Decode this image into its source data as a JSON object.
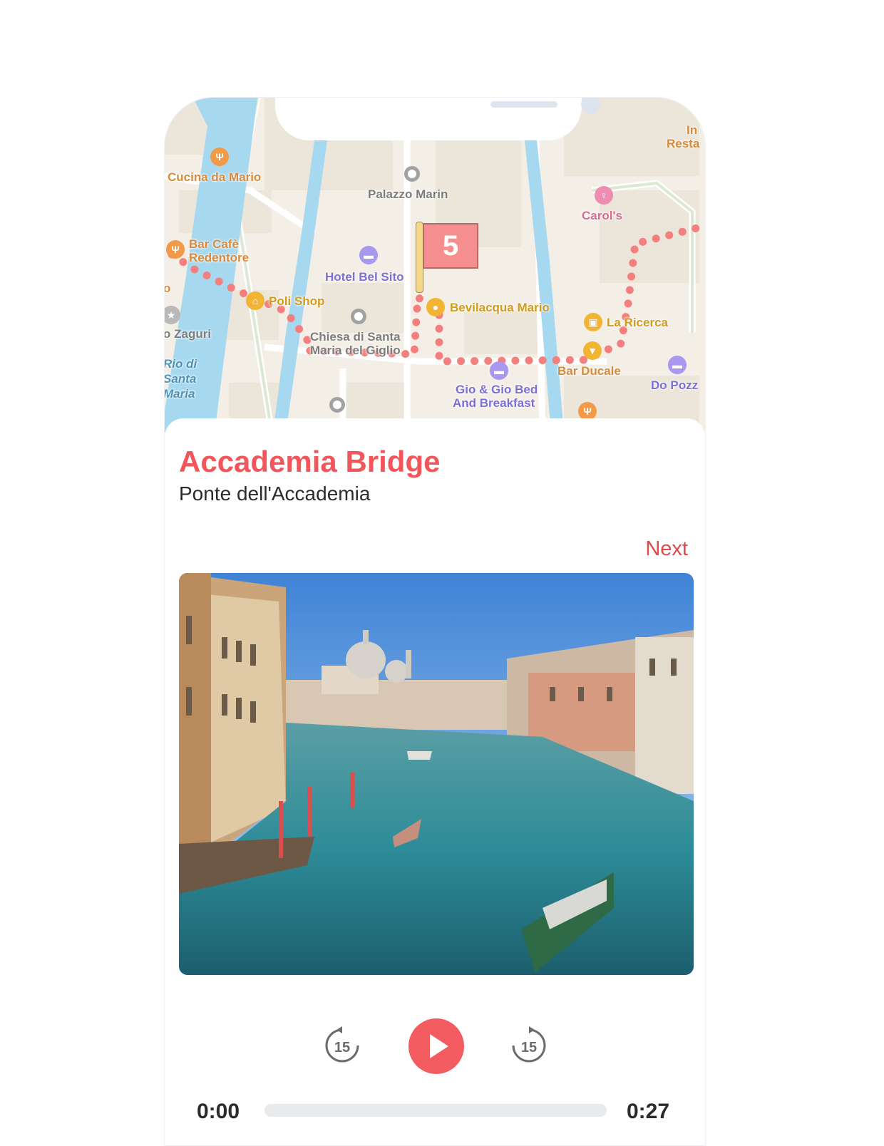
{
  "map": {
    "labels": {
      "cucina": "Cucina da Mario",
      "palazzo": "Palazzo Marin",
      "carols": "Carol's",
      "in_resta_1": "In",
      "in_resta_2": "Resta",
      "bar_cafe_1": "Bar Cafè",
      "bar_cafe_2": "Redentore",
      "hotel_bel_sito": "Hotel Bel Sito",
      "poli_shop": "Poli Shop",
      "bevilacqua": "Bevilacqua Mario",
      "la_ricerca": "La Ricerca",
      "zaguri": "o Zaguri",
      "chiesa_1": "Chiesa di Santa",
      "chiesa_2": "Maria del Giglio",
      "bar_ducale": "Bar Ducale",
      "rio_1": "Rio di",
      "rio_2": "Santa",
      "rio_3": "Maria",
      "gio_1": "Gio & Gio Bed",
      "gio_2": "And Breakfast",
      "do_pozzi": "Do Pozz",
      "o_fragment": "o"
    },
    "stop_number": "5",
    "colors": {
      "route": "#f47f7f",
      "water": "#a6d8f0",
      "flag": "#f58e8e"
    }
  },
  "sheet": {
    "title": "Accademia Bridge",
    "subtitle": "Ponte dell'Accademia",
    "next_label": "Next"
  },
  "player": {
    "rewind_seconds": "15",
    "forward_seconds": "15",
    "current_time": "0:00",
    "total_time": "0:27",
    "progress": 0,
    "accent": "#f25b60"
  }
}
